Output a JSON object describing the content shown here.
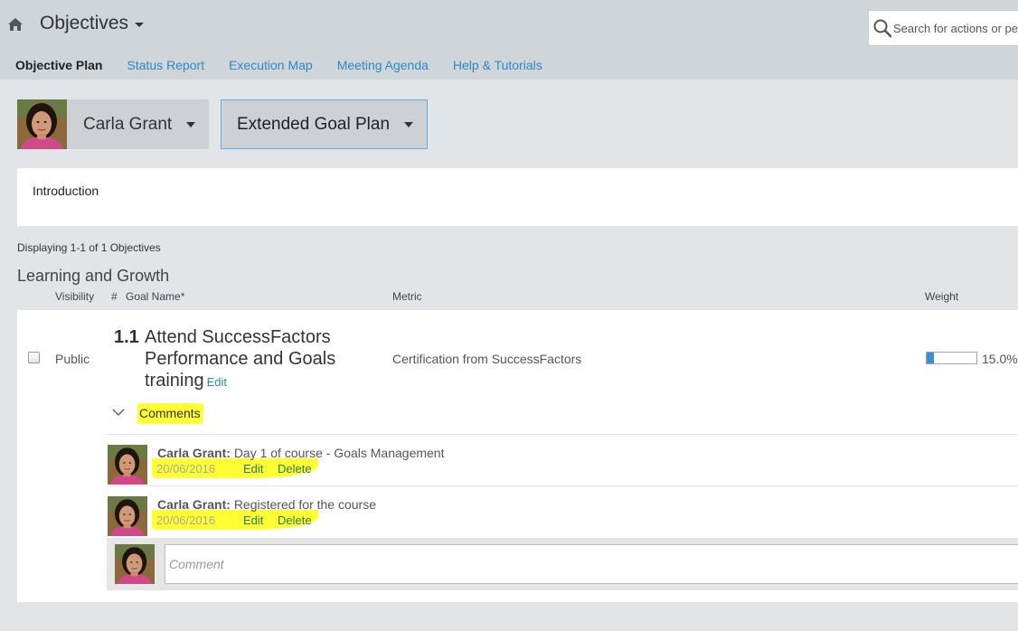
{
  "header": {
    "app_title": "Objectives",
    "search_placeholder": "Search for actions or people"
  },
  "nav": {
    "tabs": [
      {
        "label": "Objective Plan",
        "active": true
      },
      {
        "label": "Status Report",
        "active": false
      },
      {
        "label": "Execution Map",
        "active": false
      },
      {
        "label": "Meeting Agenda",
        "active": false
      },
      {
        "label": "Help & Tutorials",
        "active": false
      }
    ]
  },
  "selectors": {
    "person_name": "Carla Grant",
    "plan_name": "Extended Goal Plan"
  },
  "intro": {
    "label": "Introduction"
  },
  "list": {
    "displaying": "Displaying 1-1 of 1 Objectives",
    "section_title": "Learning and Growth",
    "columns": {
      "visibility": "Visibility",
      "number": "#",
      "goal_name": "Goal Name*",
      "metric": "Metric",
      "weight": "Weight"
    }
  },
  "objective": {
    "visibility": "Public",
    "number": "1.1",
    "name": "Attend SuccessFactors Performance and Goals training",
    "edit_label": "Edit",
    "metric": "Certification from SuccessFactors",
    "weight_label": "15.0%",
    "weight_fraction": 0.15
  },
  "comments": {
    "toggle_label": "Comments",
    "items": [
      {
        "author": "Carla Grant:",
        "text": "Day 1 of course - Goals Management",
        "date": "20/06/2016",
        "edit": "Edit",
        "delete": "Delete"
      },
      {
        "author": "Carla Grant:",
        "text": "Registered for the course",
        "date": "20/06/2016",
        "edit": "Edit",
        "delete": "Delete"
      }
    ],
    "input_placeholder": "Comment"
  },
  "colors": {
    "link_blue": "#2a8ac8",
    "highlight_yellow": "#ffff33",
    "topbar_gray": "#d0d5d9",
    "weight_bar_fill": "#3f8fd2"
  },
  "icons": {
    "home": "home-icon",
    "search": "search-icon",
    "dropdown": "caret-down-icon",
    "expand": "chevron-down-icon",
    "avatar": "user-avatar"
  }
}
